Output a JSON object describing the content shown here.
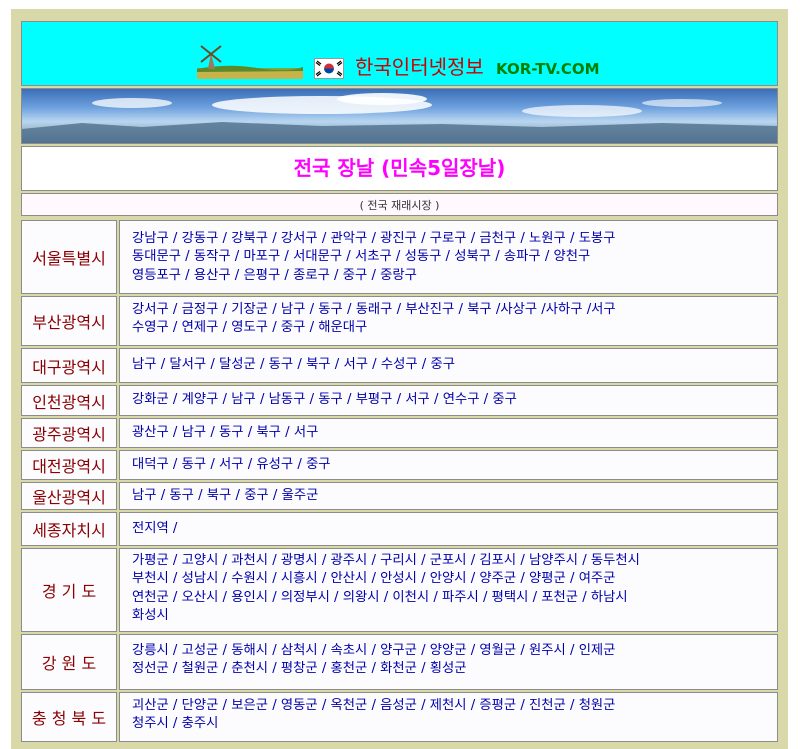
{
  "header": {
    "site_name": "한국인터넷정보",
    "domain": "KOR-TV.COM",
    "flag_icon": "korea-flag-icon",
    "windmill_icon": "windmill-icon",
    "colors": {
      "background": "#00ffff",
      "name": "#cc0000",
      "domain": "#008000"
    }
  },
  "page": {
    "title": "전국 장날 (민속5일장날)",
    "subtitle": "( 전국 재래시장 )",
    "title_color": "#ff00ff"
  },
  "regions": [
    {
      "name": "서울특별시",
      "lines": [
        "강남구 /  강동구 / 강북구 / 강서구 / 관악구 / 광진구 / 구로구 / 금천구 / 노원구 / 도봉구",
        "동대문구 / 동작구 / 마포구 / 서대문구 /  서초구 /  성동구 /  성북구 /  송파구 /   양천구",
        "영등포구 /  용산구 / 은평구 /  종로구 /  중구 /  중랑구"
      ]
    },
    {
      "name": "부산광역시",
      "lines": [
        "강서구 / 금정구 / 기장군 / 남구 / 동구 / 동래구 / 부산진구 / 북구 /사상구 /사하구 /서구",
        "수영구 /   연제구 / 영도구 / 중구 /  해운대구"
      ]
    },
    {
      "name": "대구광역시",
      "lines": [
        "남구 / 달서구 / 달성군 / 동구 / 북구 / 서구 / 수성구 / 중구"
      ]
    },
    {
      "name": "인천광역시",
      "lines": [
        "강화군 / 계양구 / 남구 / 남동구 / 동구 / 부평구 / 서구 / 연수구 / 중구"
      ]
    },
    {
      "name": "광주광역시",
      "lines": [
        "광산구 / 남구 / 동구 / 북구 / 서구"
      ]
    },
    {
      "name": "대전광역시",
      "lines": [
        "대덕구 / 동구 / 서구 / 유성구 / 중구"
      ]
    },
    {
      "name": "울산광역시",
      "lines": [
        "남구 /  동구 / 북구 / 중구 / 울주군"
      ]
    },
    {
      "name": "세종자치시",
      "lines": [
        "전지역 /"
      ]
    },
    {
      "name": "경  기  도",
      "lines": [
        "가평군 / 고양시 / 과천시 / 광명시 / 광주시 / 구리시 / 군포시 / 김포시 / 남양주시 / 동두천시",
        "부천시 / 성남시 / 수원시 / 시흥시 / 안산시 / 안성시 / 안양시 / 양주군 /   양평군 /  여주군",
        "연천군 / 오산시 / 용인시 / 의정부시 / 의왕시 / 이천시 / 파주시 / 평택시 / 포천군 /  하남시",
        "화성시"
      ]
    },
    {
      "name": "강  원  도",
      "lines": [
        "강릉시 / 고성군 / 동해시 / 삼척시 / 속초시 / 양구군 / 양양군 / 영월군 / 원주시 / 인제군",
        "정선군 / 철원군 / 춘천시 / 평창군 / 홍천군 / 화천군 / 횡성군"
      ]
    },
    {
      "name": "충 청 북 도",
      "lines": [
        "괴산군 / 단양군 / 보은군 / 영동군 / 옥천군 / 음성군 / 제천시 / 증평군 / 진천군 / 청원군",
        "청주시 / 충주시"
      ]
    }
  ]
}
